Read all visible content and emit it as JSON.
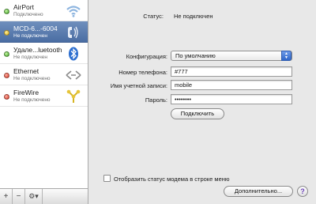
{
  "services": [
    {
      "name": "AirPort",
      "status": "Подключено",
      "dot": "green",
      "icon": "wifi-icon"
    },
    {
      "name": "MCD-6...-6004",
      "status": "Не подключен",
      "dot": "yellow",
      "icon": "modem-phone-icon",
      "selected": true
    },
    {
      "name": "Удале...luetooth",
      "status": "Не подключен",
      "dot": "green",
      "icon": "bluetooth-icon"
    },
    {
      "name": "Ethernet",
      "status": "Не подключено",
      "dot": "red",
      "icon": "ethernet-icon"
    },
    {
      "name": "FireWire",
      "status": "Не подключено",
      "dot": "red",
      "icon": "firewire-icon"
    }
  ],
  "bottom_bar": {
    "add": "+",
    "remove": "−",
    "gear": "⚙▾"
  },
  "main": {
    "status_label": "Статус:",
    "status_value": "Не подключен",
    "config_label": "Конфигурация:",
    "config_value": "По умолчанию",
    "phone_label": "Номер телефона:",
    "phone_value": "#777",
    "account_label": "Имя учетной записи:",
    "account_value": "mobile",
    "password_label": "Пароль:",
    "password_value": "••••••••",
    "connect_button": "Подключить",
    "show_modem_status": "Отобразить статус модема в строке меню",
    "advanced_button": "Дополнительно...",
    "help_button": "?"
  },
  "colors": {
    "selected_row": "#4a6da3",
    "window_bg": "#e8e8e8",
    "accent_blue": "#2f66c8"
  }
}
